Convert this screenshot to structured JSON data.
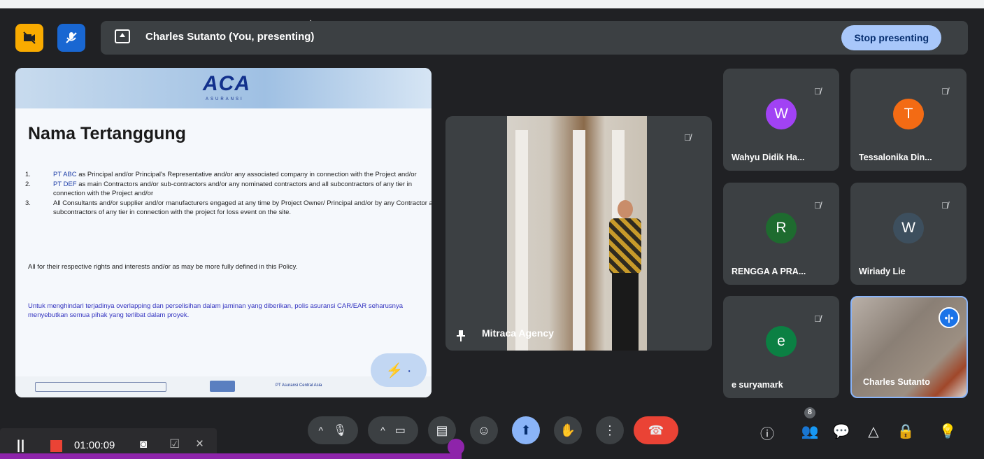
{
  "presenting": {
    "label": "Charles Sutanto (You, presenting)",
    "stop_label": "Stop presenting"
  },
  "slide": {
    "logo": "ACA",
    "logo_sub": "ASURANSI",
    "title": "Nama Tertanggung",
    "items": [
      {
        "num": "1.",
        "highlight": "PT ABC",
        "text": " as Principal and/or Principal's Representative and/or any associated company in connection with the Project and/or"
      },
      {
        "num": "2.",
        "highlight": "PT DEF",
        "text": " as main Contractors and/or sub-contractors and/or any nominated contractors and all subcontractors of any tier in connection with the Project and/or"
      },
      {
        "num": "3.",
        "highlight": "",
        "text": "All Consultants and/or supplier and/or manufacturers engaged at any time by Project Owner/ Principal and/or by any Contractor and subcontractors of any tier in connection with the project for loss event on the site."
      }
    ],
    "paragraph": "All for their respective rights and interests and/or as may be more fully defined in this Policy.",
    "note": "Untuk menghindari terjadinya overlapping dan perselisihan dalam jaminan yang diberikan, polis asuransi CAR/EAR seharusnya menyebutkan semua pihak yang terlibat dalam proyek.",
    "footer_text": "PT Asuransi Central Asia",
    "fab_icon": "⚡ ·"
  },
  "main_video": {
    "name": "Mitraca Agency"
  },
  "participants": [
    {
      "initial": "W",
      "name": "Wahyu Didik Ha...",
      "color": "#a142f4"
    },
    {
      "initial": "T",
      "name": "Tessalonika Din...",
      "color": "#f36b14"
    },
    {
      "initial": "R",
      "name": "RENGGA A PRA...",
      "color": "#1e6b2f"
    },
    {
      "initial": "W",
      "name": "Wiriady Lie",
      "color": "#3d4f5e"
    },
    {
      "initial": "e",
      "name": "e suryamark",
      "color": "#0b8043"
    }
  ],
  "self_tile": {
    "name": "Charles Sutanto"
  },
  "controls": {
    "people_count": "8"
  },
  "recording": {
    "time": "01:00:09"
  },
  "icons": {
    "mute": "🎙̸",
    "chevron": "^",
    "mic": "🎙",
    "camera": "▭",
    "captions": "▤",
    "emoji": "☺",
    "present": "⬆",
    "hand": "✋",
    "more": "⋮",
    "hangup": "☎",
    "info": "ⓘ",
    "people": "👥",
    "chat": "💬",
    "activities": "△",
    "lock": "🔒",
    "bulb": "💡"
  }
}
